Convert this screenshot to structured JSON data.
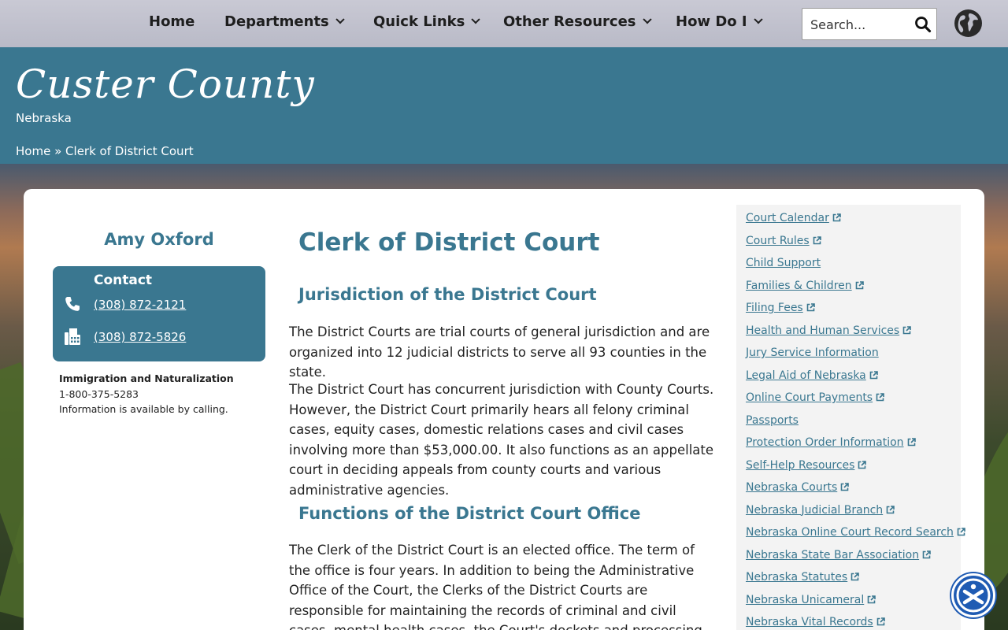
{
  "colors": {
    "primary": "#3a7790",
    "nav_bg": "#c2c3ce",
    "link": "#3a7790",
    "a11y": "#1f5bb3"
  },
  "nav": {
    "items": [
      {
        "label": "Home",
        "has_dropdown": false
      },
      {
        "label": "Departments",
        "has_dropdown": true
      },
      {
        "label": "Quick Links",
        "has_dropdown": true
      },
      {
        "label": "Other Resources",
        "has_dropdown": true
      },
      {
        "label": "How Do I",
        "has_dropdown": true
      }
    ],
    "search_placeholder": "Search...",
    "icons": {
      "search": "search-icon",
      "globe": "globe-icon"
    }
  },
  "header": {
    "title": "Custer County",
    "subtitle": "Nebraska",
    "breadcrumb": {
      "home": "Home",
      "separator": "»",
      "current": "Clerk of District Court"
    }
  },
  "sidebar": {
    "person": "Amy Oxford",
    "contact": {
      "title": "Contact",
      "phone": "(308) 872-2121",
      "fax": "(308) 872-5826"
    },
    "extra": {
      "heading": "Immigration and Naturalization",
      "phone": "1-800-375-5283",
      "note": "Information is available by calling."
    }
  },
  "main": {
    "title": "Clerk of District Court",
    "section1_heading": "Jurisdiction of the District Court",
    "para1": "The District Courts are trial courts of general jurisdiction and are organized into 12 judicial districts to serve all 93 counties in the state.",
    "para2": "The District Court has concurrent jurisdiction with County Courts. However, the District Court primarily hears all felony criminal cases, equity cases, domestic relations cases and civil cases involving more than $53,000.00. It also functions as an appellate court in deciding appeals from county courts and various administrative agencies.",
    "section2_heading": "Functions of the District Court Office",
    "para3": "The Clerk of the District Court is an elected office. The term of the office is four years.  In addition to being the Administrative Office of the Court, the Clerks of the District Courts are responsible for maintaining the records of criminal and civil cases, mental health cases, the Court's dockets and processing judgments."
  },
  "links": [
    {
      "label": "Court Calendar",
      "external": true
    },
    {
      "label": "Court Rules",
      "external": true
    },
    {
      "label": "Child Support",
      "external": false
    },
    {
      "label": "Families & Children",
      "external": true
    },
    {
      "label": "Filing Fees",
      "external": true
    },
    {
      "label": "Health and Human Services",
      "external": true
    },
    {
      "label": "Jury Service Information",
      "external": false
    },
    {
      "label": "Legal Aid of Nebraska",
      "external": true
    },
    {
      "label": "Online Court Payments",
      "external": true
    },
    {
      "label": "Passports",
      "external": false
    },
    {
      "label": "Protection Order Information",
      "external": true
    },
    {
      "label": "Self-Help Resources",
      "external": true
    },
    {
      "label": "Nebraska Courts",
      "external": true
    },
    {
      "label": "Nebraska Judicial Branch",
      "external": true
    },
    {
      "label": "Nebraska Online Court Record Search",
      "external": true
    },
    {
      "label": "Nebraska State Bar Association",
      "external": true
    },
    {
      "label": "Nebraska Statutes",
      "external": true
    },
    {
      "label": "Nebraska Unicameral",
      "external": true
    },
    {
      "label": "Nebraska Vital Records",
      "external": true
    }
  ],
  "accessibility": {
    "icon": "accessibility-icon"
  }
}
